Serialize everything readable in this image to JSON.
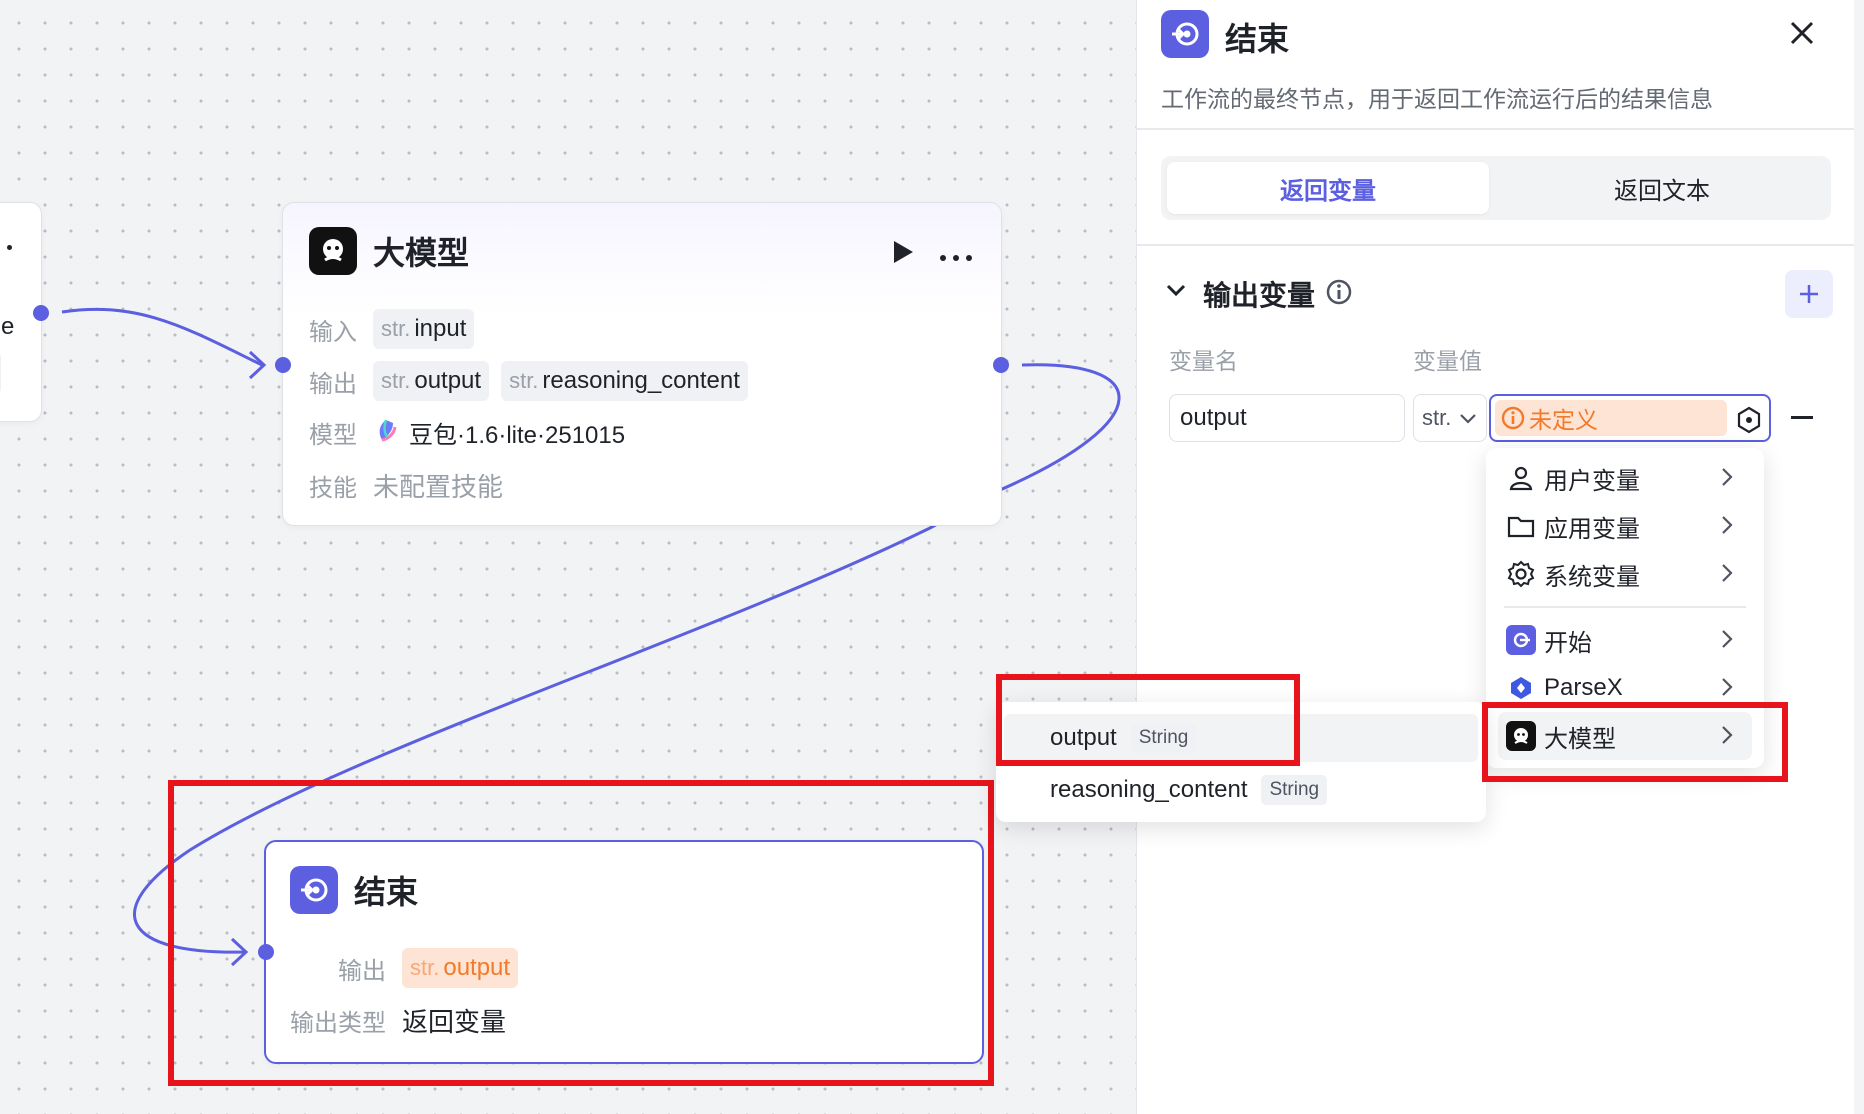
{
  "canvas": {
    "llm_node": {
      "title": "大模型",
      "input_label": "输入",
      "output_label": "输出",
      "model_label": "模型",
      "skill_label": "技能",
      "input_var": {
        "type": "str.",
        "name": "input"
      },
      "outputs": [
        {
          "type": "str.",
          "name": "output"
        },
        {
          "type": "str.",
          "name": "reasoning_content"
        }
      ],
      "model_name": "豆包·1.6·lite·251015",
      "skill_value": "未配置技能"
    },
    "end_node": {
      "title": "结束",
      "output_label": "输出",
      "output_var": {
        "type": "str.",
        "name": "output"
      },
      "output_type_label": "输出类型",
      "output_type_value": "返回变量"
    },
    "partial_node_text": "e"
  },
  "panel": {
    "title": "结束",
    "description": "工作流的最终节点，用于返回工作流运行后的结果信息",
    "tabs": [
      {
        "label": "返回变量",
        "active": true
      },
      {
        "label": "返回文本",
        "active": false
      }
    ],
    "section_title": "输出变量",
    "col_name": "变量名",
    "col_value": "变量值",
    "var_name": "output",
    "var_type": "str.",
    "var_value_status": "未定义"
  },
  "dropdown": {
    "items": [
      {
        "label": "用户变量",
        "icon": "user-icon"
      },
      {
        "label": "应用变量",
        "icon": "folder-icon"
      },
      {
        "label": "系统变量",
        "icon": "gear-icon"
      },
      {
        "label": "开始",
        "icon": "start-node-icon"
      },
      {
        "label": "ParseX",
        "icon": "parsex-icon"
      },
      {
        "label": "大模型",
        "icon": "llm-node-icon"
      }
    ]
  },
  "submenu": {
    "items": [
      {
        "name": "output",
        "type": "String"
      },
      {
        "name": "reasoning_content",
        "type": "String"
      }
    ]
  },
  "colors": {
    "accent": "#5b5fe0",
    "warning": "#f27a2b",
    "highlight_box": "#e8141c"
  }
}
